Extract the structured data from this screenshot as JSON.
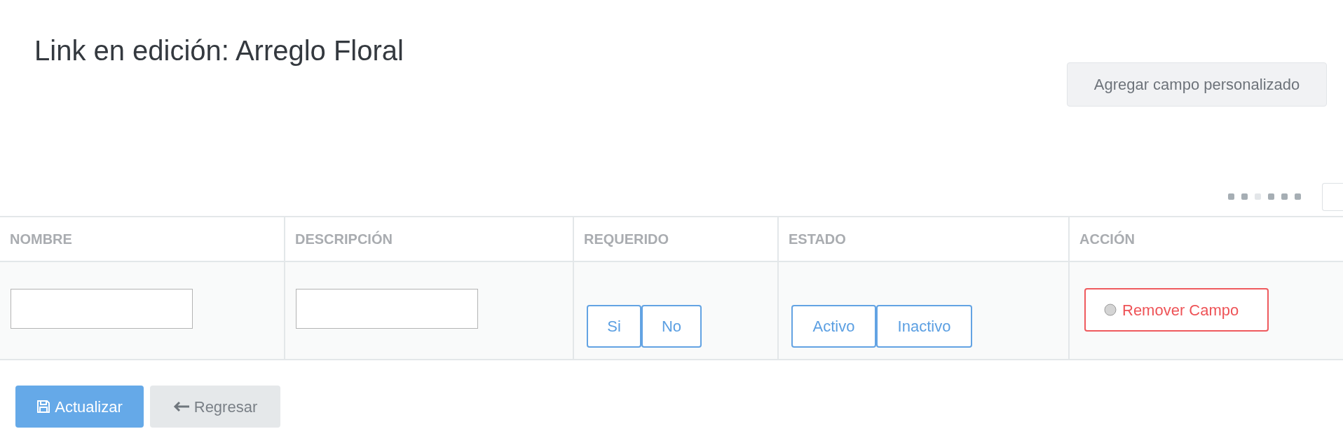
{
  "title": "Link en edición: Arreglo Floral",
  "add_button": "Agregar campo personalizado",
  "pager_dots": [
    {
      "selected": false
    },
    {
      "selected": false
    },
    {
      "selected": true
    },
    {
      "selected": false
    },
    {
      "selected": false
    },
    {
      "selected": false
    }
  ],
  "table": {
    "columns": [
      "NOMBRE",
      "DESCRIPCIÓN",
      "REQUERIDO",
      "ESTADO",
      "ACCIÓN"
    ],
    "rows": [
      {
        "nombre": {
          "kind": "text"
        },
        "descripcion": {
          "kind": "text"
        },
        "requerido": [
          "Si",
          "No"
        ],
        "estado": [
          "Activo",
          "Inactivo"
        ],
        "accion": "Remover Campo"
      }
    ]
  },
  "buttons": [
    {
      "kind": "primary",
      "label": "Actualizar"
    },
    {
      "kind": "back",
      "label": "Regresar"
    }
  ]
}
